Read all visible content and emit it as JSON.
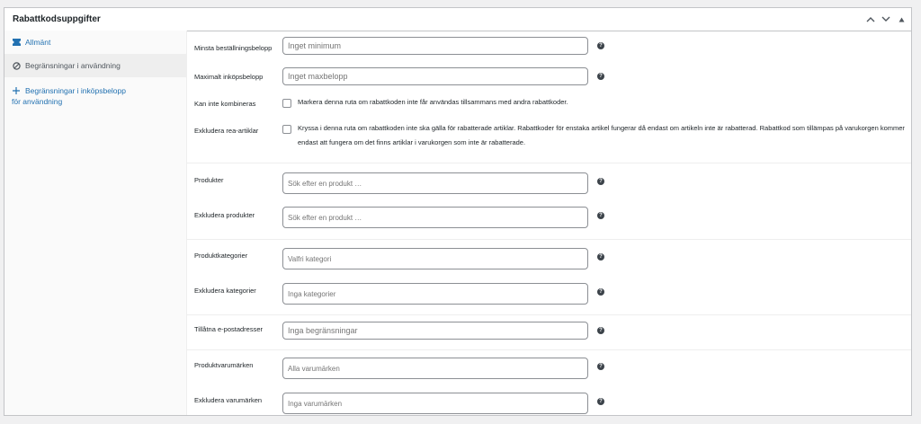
{
  "panel": {
    "title": "Rabattkodsuppgifter",
    "header_buttons": [
      "chevron-up-icon",
      "chevron-down-icon",
      "triangle-up-icon"
    ]
  },
  "sidebar": {
    "items": [
      {
        "label": "Allmänt",
        "icon": "ticket-icon",
        "active": false
      },
      {
        "label": "Begränsningar i användning",
        "icon": "blocked-icon",
        "active": true
      },
      {
        "label": "Begränsningar i inköpsbelopp",
        "label_line2": "för användning",
        "icon": "plus-icon",
        "active": false
      }
    ]
  },
  "fields": {
    "min_amount": {
      "label": "Minsta beställningsbelopp",
      "placeholder": "Inget minimum"
    },
    "max_amount": {
      "label": "Maximalt inköpsbelopp",
      "placeholder": "Inget maxbelopp"
    },
    "individual_use": {
      "label": "Kan inte kombineras",
      "text": "Markera denna ruta om rabattkoden inte får användas tillsammans med andra rabattkoder."
    },
    "exclude_sale": {
      "label": "Exkludera rea-artiklar",
      "text": "Kryssa i denna ruta om rabattkoden inte ska gälla för rabatterade artiklar. Rabattkoder för enstaka artikel fungerar då endast om artikeln inte är rabatterad. Rabattkod som tillämpas på varukorgen kommer endast att fungera om det finns artiklar i varukorgen som inte är rabatterade."
    },
    "products": {
      "label": "Produkter",
      "placeholder": "Sök efter en produkt …"
    },
    "exclude_products": {
      "label": "Exkludera produkter",
      "placeholder": "Sök efter en produkt …"
    },
    "categories": {
      "label": "Produktkategorier",
      "placeholder": "Valfri kategori"
    },
    "exclude_categories": {
      "label": "Exkludera kategorier",
      "placeholder": "Inga kategorier"
    },
    "emails": {
      "label": "Tillåtna e-postadresser",
      "placeholder": "Inga begränsningar"
    },
    "brands": {
      "label": "Produktvarumärken",
      "placeholder": "Alla varumärken"
    },
    "exclude_brands": {
      "label": "Exkludera varumärken",
      "placeholder": "Inga varumärken"
    }
  },
  "help_icon": "question-circle-icon"
}
